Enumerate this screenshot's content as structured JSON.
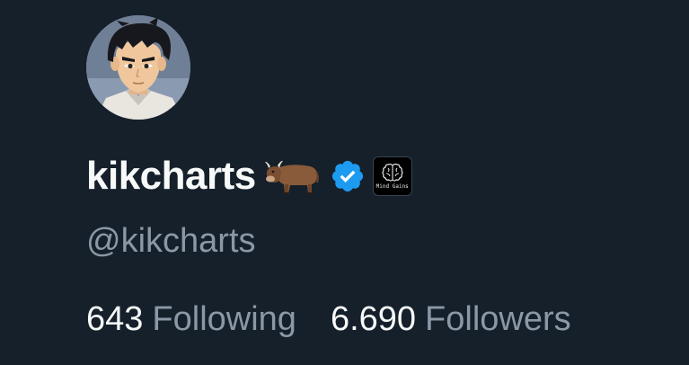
{
  "profile": {
    "display_name": "kikcharts",
    "handle": "@kikcharts",
    "name_emoji": "ox-emoji",
    "verified_badge": "verified-badge-icon",
    "affiliate_badge": {
      "icon": "brain-icon",
      "label": "Mind Gains"
    }
  },
  "stats": {
    "following_count": "643",
    "following_label": "Following",
    "followers_count": "6.690",
    "followers_label": "Followers"
  },
  "colors": {
    "background": "#15202b",
    "primary_text": "#f7f9f9",
    "secondary_text": "#8b98a5",
    "verified_blue": "#1d9bf0"
  }
}
